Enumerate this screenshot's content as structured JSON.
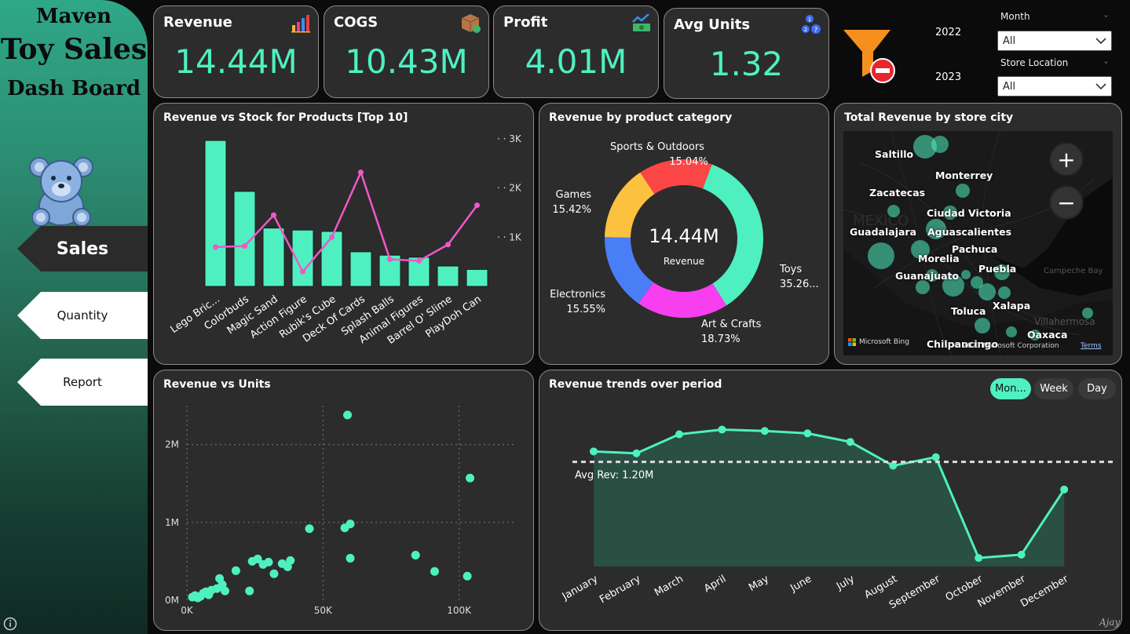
{
  "sidebar": {
    "logo_line1": "Maven",
    "logo_line2": "Toy Sales",
    "logo_line3": "Dash Board",
    "nav": [
      {
        "label": "Sales"
      },
      {
        "label": "Quantity"
      },
      {
        "label": "Report"
      }
    ],
    "info_icon": "info-icon"
  },
  "kpis": [
    {
      "title": "Revenue",
      "value": "14.44M",
      "icon": "bar-chart-icon"
    },
    {
      "title": "COGS",
      "value": "10.43M",
      "icon": "box-icon"
    },
    {
      "title": "Profit",
      "value": "4.01M",
      "icon": "money-trend-icon"
    },
    {
      "title": "Avg Units",
      "value": "1.32",
      "icon": "question-numbers-icon"
    }
  ],
  "filters": {
    "years": [
      "2022",
      "2023"
    ],
    "month_label": "Month",
    "month_value": "All",
    "store_label": "Store Location",
    "store_value": "All",
    "clear_icon": "clear-filter-icon"
  },
  "chart_data": [
    {
      "type": "bar",
      "title": "Revenue vs Stock for Products [Top 10]",
      "categories": [
        "Lego Bric...",
        "Colorbuds",
        "Magic Sand",
        "Action Figure",
        "Rubik's Cube",
        "Deck Of Cards",
        "Splash Balls",
        "Animal Figures",
        "Barrel O' Slime",
        "PlayDoh Can"
      ],
      "series": [
        {
          "values": [
            2.15,
            1.4,
            0.86,
            0.83,
            0.81,
            0.51,
            0.46,
            0.43,
            0.3,
            0.25
          ]
        },
        {
          "values": [
            800,
            820,
            1450,
            300,
            1000,
            2320,
            550,
            520,
            850,
            1650
          ]
        }
      ],
      "y2_ticks": [
        "1K",
        "2K",
        "3K"
      ],
      "y2lim": [
        0,
        3000
      ]
    },
    {
      "type": "pie",
      "title": "Revenue by product category",
      "center_value": "14.44M",
      "center_label": "Revenue",
      "slices": [
        {
          "name": "Toys",
          "value": 35.26,
          "label": "35.26...",
          "color": "#4ff0c0"
        },
        {
          "name": "Art & Crafts",
          "value": 18.73,
          "label": "18.73%",
          "color": "#f73ff0"
        },
        {
          "name": "Electronics",
          "value": 15.55,
          "label": "15.55%",
          "color": "#4a7ef7"
        },
        {
          "name": "Games",
          "value": 15.42,
          "label": "15.42%",
          "color": "#fcc13f"
        },
        {
          "name": "Sports & Outdoors",
          "value": 15.04,
          "label": "15.04%",
          "color": "#fc4646"
        }
      ]
    },
    {
      "type": "scatter",
      "title": "Revenue vs Units",
      "x_ticks": [
        "0K",
        "50K",
        "100K"
      ],
      "y_ticks": [
        "0M",
        "1M",
        "2M"
      ],
      "xlim": [
        0,
        120000
      ],
      "ylim": [
        0,
        2500000
      ],
      "points": [
        [
          2000,
          40000
        ],
        [
          3000,
          60000
        ],
        [
          4000,
          30000
        ],
        [
          5000,
          50000
        ],
        [
          6000,
          90000
        ],
        [
          7000,
          110000
        ],
        [
          8000,
          70000
        ],
        [
          9000,
          130000
        ],
        [
          11000,
          150000
        ],
        [
          12000,
          280000
        ],
        [
          13000,
          200000
        ],
        [
          14000,
          120000
        ],
        [
          18000,
          380000
        ],
        [
          23000,
          120000
        ],
        [
          24000,
          500000
        ],
        [
          26000,
          530000
        ],
        [
          28000,
          460000
        ],
        [
          30000,
          490000
        ],
        [
          32000,
          340000
        ],
        [
          35000,
          470000
        ],
        [
          37000,
          430000
        ],
        [
          38000,
          510000
        ],
        [
          45000,
          920000
        ],
        [
          58000,
          930000
        ],
        [
          60000,
          980000
        ],
        [
          60000,
          540000
        ],
        [
          59000,
          2380000
        ],
        [
          84000,
          580000
        ],
        [
          91000,
          370000
        ],
        [
          103000,
          310000
        ],
        [
          104000,
          1570000
        ]
      ]
    },
    {
      "type": "area",
      "title": "Revenue trends over period",
      "categories": [
        "January",
        "February",
        "March",
        "April",
        "May",
        "June",
        "July",
        "August",
        "September",
        "October",
        "November",
        "December"
      ],
      "values": [
        1.42,
        1.38,
        1.78,
        1.88,
        1.85,
        1.8,
        1.62,
        1.12,
        1.3,
        -0.82,
        -0.75,
        0.62
      ],
      "avg_label": "Avg Rev: 1.20M",
      "avg_value": 1.2,
      "ylim": [
        -1.0,
        2.3
      ],
      "toggles": [
        "Mon...",
        "Week",
        "Day"
      ]
    }
  ],
  "map": {
    "title": "Total Revenue by store city",
    "cities": [
      "Saltillo",
      "Monterrey",
      "Zacatecas",
      "Ciudad Victoria",
      "Guadalajara",
      "Aguascalientes",
      "Pachuca",
      "Morelia",
      "Guanajuato",
      "Puebla",
      "Toluca",
      "Xalapa",
      "Oaxaca",
      "Chilpancingo"
    ],
    "region_labels": [
      "Campeche Bay",
      "Villahermosa",
      "Mexico"
    ],
    "attribution": "Microsoft Bing",
    "copyright": "© 2023 Microsoft Corporation",
    "terms": "Terms",
    "zoom_in": "+",
    "zoom_out": "−"
  },
  "signature": "Ajay"
}
